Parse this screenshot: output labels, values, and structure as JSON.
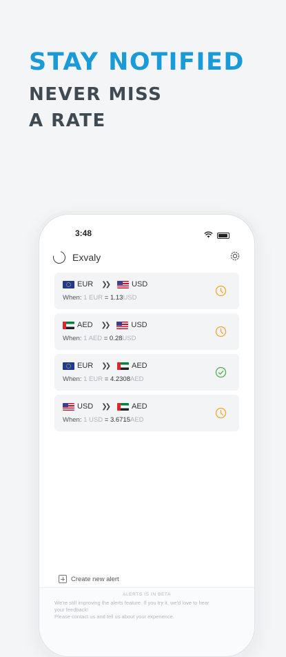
{
  "hero": {
    "title": "STAY NOTIFIED",
    "subtitle_line1": "NEVER MISS",
    "subtitle_line2": "A RATE"
  },
  "status_bar": {
    "time": "3:48"
  },
  "app": {
    "name": "Exvaly"
  },
  "alerts": [
    {
      "from": "EUR",
      "to": "USD",
      "when_label": "When:",
      "base": "1 EUR",
      "eq": "=",
      "value": "1.13",
      "quote": "USD",
      "status": "pending"
    },
    {
      "from": "AED",
      "to": "USD",
      "when_label": "When:",
      "base": "1 AED",
      "eq": "=",
      "value": "0.28",
      "quote": "USD",
      "status": "pending"
    },
    {
      "from": "EUR",
      "to": "AED",
      "when_label": "When:",
      "base": "1 EUR",
      "eq": "=",
      "value": "4.2308",
      "quote": "AED",
      "status": "triggered"
    },
    {
      "from": "USD",
      "to": "AED",
      "when_label": "When:",
      "base": "1 USD",
      "eq": "=",
      "value": "3.6715",
      "quote": "AED",
      "status": "pending"
    }
  ],
  "create_alert": "Create new alert",
  "beta": {
    "title": "ALERTS IS IN BETA",
    "line1": "We're still improving the alerts feature. If you try it, we'd love to hear",
    "line2": "your feedback!",
    "line3": "Please contact us and tell us about your experience."
  },
  "colors": {
    "accent": "#1a9ad6",
    "pending": "#f0a531",
    "triggered": "#4caf50"
  }
}
